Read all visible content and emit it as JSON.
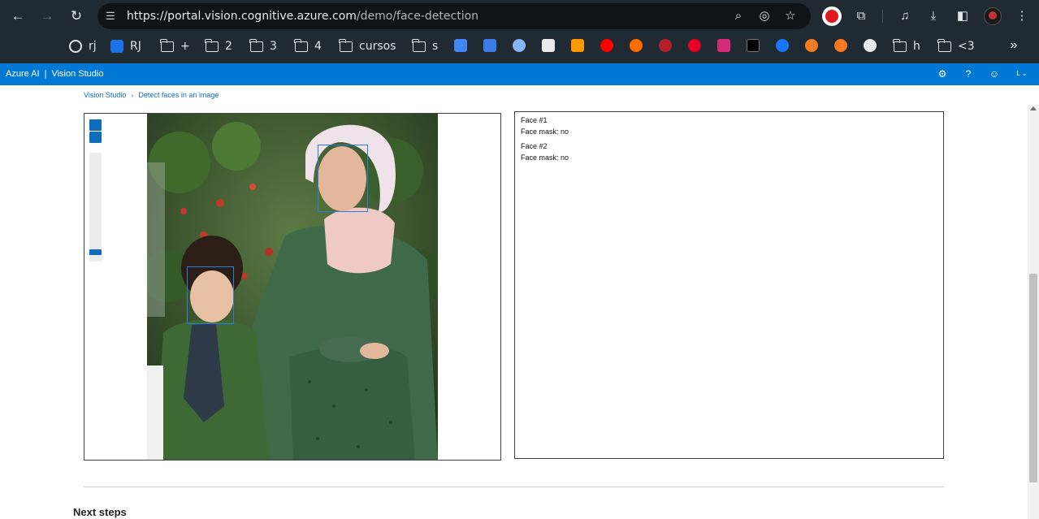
{
  "browser": {
    "url_host": "https://portal.vision.cognitive.azure.com",
    "url_path": "/demo/face-detection",
    "toolbar_icons": [
      "back-icon",
      "forward-icon",
      "reload-icon",
      "site-settings-icon",
      "zoom-icon",
      "eye-off-icon",
      "star-icon",
      "extension-icon",
      "puzzle-icon",
      "media-icon",
      "download-icon",
      "sidebar-icon",
      "profile-avatar",
      "menu-icon"
    ],
    "bookmarks": [
      {
        "label": "",
        "icon": "whatsapp-icon"
      },
      {
        "label": "",
        "icon": "gmail-icon"
      },
      {
        "label": "rj",
        "icon": "globe-icon"
      },
      {
        "label": "RJ",
        "icon": "site-icon"
      },
      {
        "label": "+",
        "icon": "folder-icon"
      },
      {
        "label": "2",
        "icon": "folder-icon"
      },
      {
        "label": "3",
        "icon": "folder-icon"
      },
      {
        "label": "4",
        "icon": "folder-icon"
      },
      {
        "label": "cursos",
        "icon": "folder-icon"
      },
      {
        "label": "s",
        "icon": "folder-icon"
      },
      {
        "label": "h",
        "icon": "folder-icon"
      },
      {
        "label": "<3",
        "icon": "folder-icon"
      }
    ]
  },
  "header": {
    "brand": "Azure AI",
    "separator": "|",
    "product": "Vision Studio",
    "icons": [
      "settings-icon",
      "help-icon",
      "feedback-icon",
      "account-icon"
    ],
    "account_initial": "L",
    "color": "#0078d4"
  },
  "breadcrumb": {
    "root": "Vision Studio",
    "current": "Detect faces in an image"
  },
  "results": {
    "faces": [
      {
        "title": "Face #1",
        "mask_label": "Face mask: no"
      },
      {
        "title": "Face #2",
        "mask_label": "Face mask: no"
      }
    ]
  },
  "next_steps": {
    "title": "Next steps"
  }
}
